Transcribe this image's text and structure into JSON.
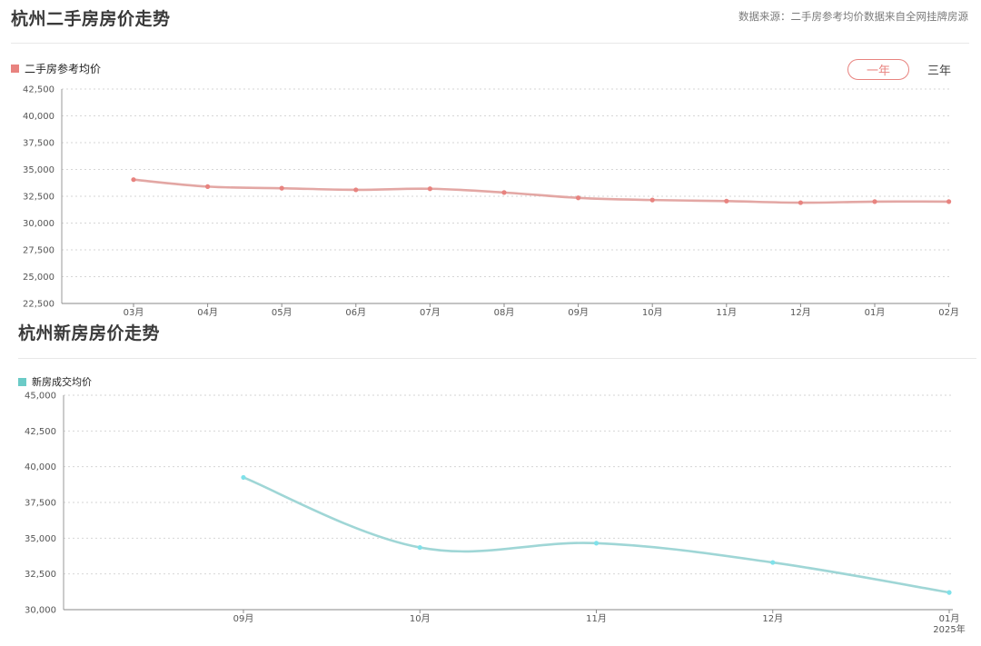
{
  "header": {
    "title": "杭州二手房房价走势",
    "source": "数据来源：二手房参考均价数据来自全网挂牌房源"
  },
  "toggles": {
    "one_year": "一年",
    "three_year": "三年",
    "selected": "一年"
  },
  "section2": {
    "title": "杭州新房房价走势"
  },
  "colors": {
    "secondhand": "#e8837f",
    "secondhand_line": "#e3a7a4",
    "newhouse": "#6bcbc7",
    "newhouse_point": "#7fe1ea"
  },
  "chart_data": [
    {
      "type": "line",
      "title": "杭州二手房房价走势",
      "series": [
        {
          "name": "二手房参考均价",
          "values": [
            34050,
            33400,
            33250,
            33100,
            33200,
            32850,
            32350,
            32150,
            32050,
            31900,
            32000,
            32000
          ]
        }
      ],
      "categories": [
        "03月",
        "04月",
        "05月",
        "06月",
        "07月",
        "08月",
        "09月",
        "10月",
        "11月",
        "12月",
        "01月",
        "02月"
      ],
      "ylim": [
        22500,
        42500
      ],
      "yticks": [
        "42,500",
        "40,000",
        "37,500",
        "35,000",
        "32,500",
        "30,000",
        "27,500",
        "25,000",
        "22,500"
      ],
      "grid": true,
      "legend_position": "top-left"
    },
    {
      "type": "line",
      "title": "杭州新房房价走势",
      "series": [
        {
          "name": "新房成交均价",
          "values": [
            39250,
            34350,
            34650,
            33300,
            31200
          ]
        }
      ],
      "categories": [
        "09月",
        "10月",
        "11月",
        "12月",
        "01月"
      ],
      "category_sublabels": [
        "",
        "",
        "",
        "",
        "2025年"
      ],
      "ylim": [
        30000,
        45000
      ],
      "yticks": [
        "45,000",
        "42,500",
        "40,000",
        "37,500",
        "35,000",
        "32,500",
        "30,000"
      ],
      "grid": true,
      "legend_position": "top-left"
    }
  ]
}
